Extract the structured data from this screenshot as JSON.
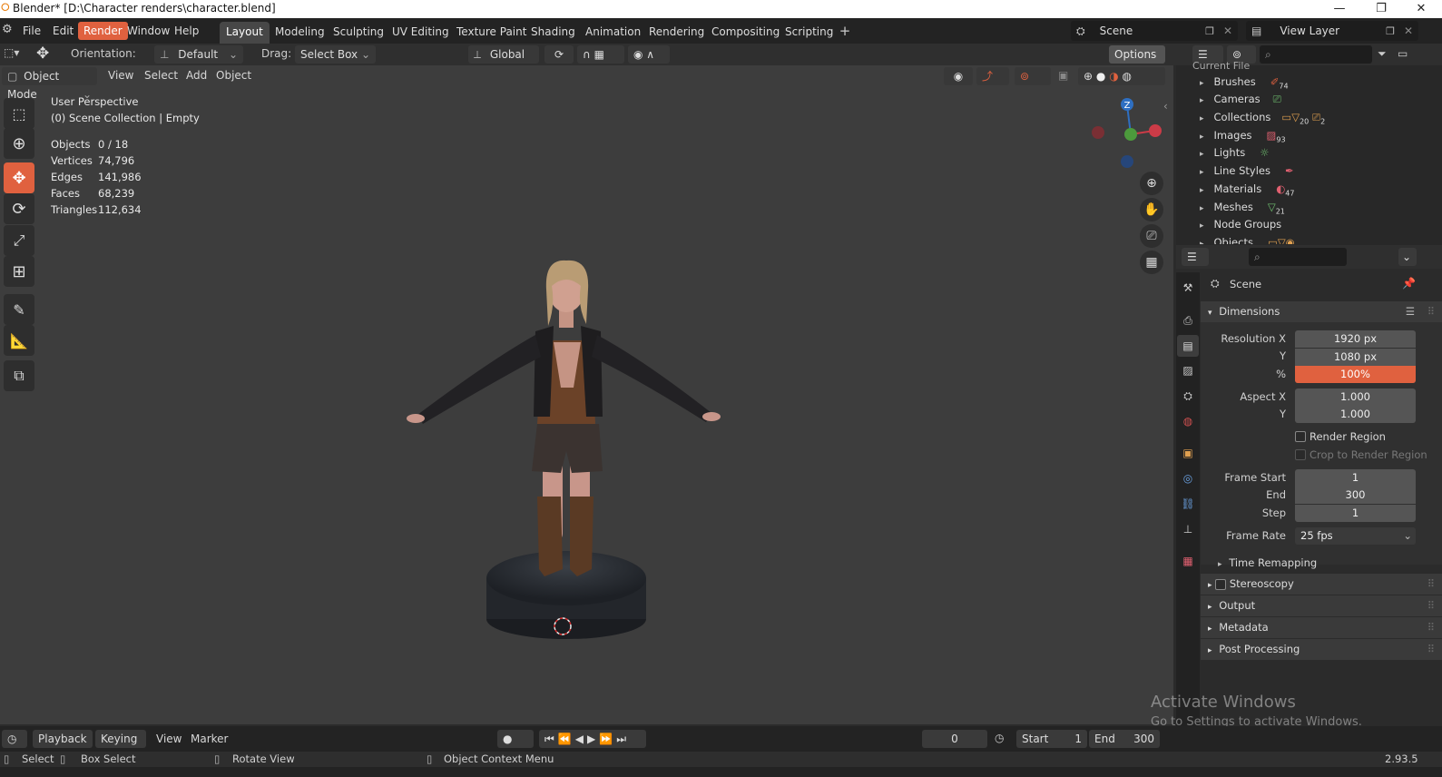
{
  "window": {
    "title": "Blender* [D:\\Character renders\\character.blend]",
    "minimize": "—",
    "restore": "❐",
    "close": "✕"
  },
  "menu": {
    "file": "File",
    "edit": "Edit",
    "render": "Render",
    "window": "Window",
    "help": "Help"
  },
  "workspaces": [
    "Layout",
    "Modeling",
    "Sculpting",
    "UV Editing",
    "Texture Paint",
    "Shading",
    "Animation",
    "Rendering",
    "Compositing",
    "Scripting"
  ],
  "scene": {
    "label": "Scene",
    "view_layer": "View Layer"
  },
  "toolheader": {
    "orientation_label": "Orientation:",
    "orientation_value": "Default",
    "drag_label": "Drag:",
    "drag_value": "Select Box",
    "transform_orientation": "Global",
    "options": "Options"
  },
  "viewport_header": {
    "mode": "Object Mode",
    "view": "View",
    "select": "Select",
    "add": "Add",
    "object": "Object"
  },
  "viewport": {
    "perspective": "User Perspective",
    "collection": "(0) Scene Collection | Empty",
    "stats": [
      {
        "label": "Objects",
        "value": "0 / 18"
      },
      {
        "label": "Vertices",
        "value": "74,796"
      },
      {
        "label": "Edges",
        "value": "141,986"
      },
      {
        "label": "Faces",
        "value": "68,239"
      },
      {
        "label": "Triangles",
        "value": "112,634"
      }
    ],
    "gizmo": {
      "z": "Z"
    }
  },
  "outliner": {
    "header_partial": "Current File",
    "items": [
      {
        "label": "Brushes",
        "count": "74"
      },
      {
        "label": "Cameras",
        "count": ""
      },
      {
        "label": "Collections",
        "count": "20"
      },
      {
        "label": "Images",
        "count": "93"
      },
      {
        "label": "Lights",
        "count": ""
      },
      {
        "label": "Line Styles",
        "count": ""
      },
      {
        "label": "Materials",
        "count": "47"
      },
      {
        "label": "Meshes",
        "count": "21"
      },
      {
        "label": "Node Groups",
        "count": ""
      },
      {
        "label": "Objects",
        "count": ""
      }
    ],
    "collections_extra_count": "2"
  },
  "properties": {
    "context": "Scene",
    "dimensions_title": "Dimensions",
    "resolution_x_label": "Resolution X",
    "resolution_x": "1920 px",
    "y_label": "Y",
    "resolution_y": "1080 px",
    "percent_label": "%",
    "percent": "100%",
    "percent_fill": 1.0,
    "aspect_x_label": "Aspect X",
    "aspect_x": "1.000",
    "aspect_y_label": "Y",
    "aspect_y": "1.000",
    "render_region": "Render Region",
    "crop_region": "Crop to Render Region",
    "frame_start_label": "Frame Start",
    "frame_start": "1",
    "end_label": "End",
    "frame_end": "300",
    "step_label": "Step",
    "frame_step": "1",
    "frame_rate_label": "Frame Rate",
    "frame_rate": "25 fps",
    "time_remapping": "Time Remapping",
    "stereoscopy": "Stereoscopy",
    "output": "Output",
    "metadata": "Metadata",
    "post_processing": "Post Processing"
  },
  "timeline": {
    "playback": "Playback",
    "keying": "Keying",
    "view": "View",
    "marker": "Marker",
    "current_frame": "0",
    "start_label": "Start",
    "start": "1",
    "end_label": "End",
    "end": "300"
  },
  "status": {
    "select": "Select",
    "box_select": "Box Select",
    "rotate_view": "Rotate View",
    "context_menu": "Object Context Menu",
    "version": "2.93.5"
  },
  "watermark": {
    "line1": "Activate Windows",
    "line2": "Go to Settings to activate Windows."
  },
  "colors": {
    "accent": "#e0613f",
    "panel": "#2b2b2b",
    "viewport": "#3d3d3d"
  }
}
